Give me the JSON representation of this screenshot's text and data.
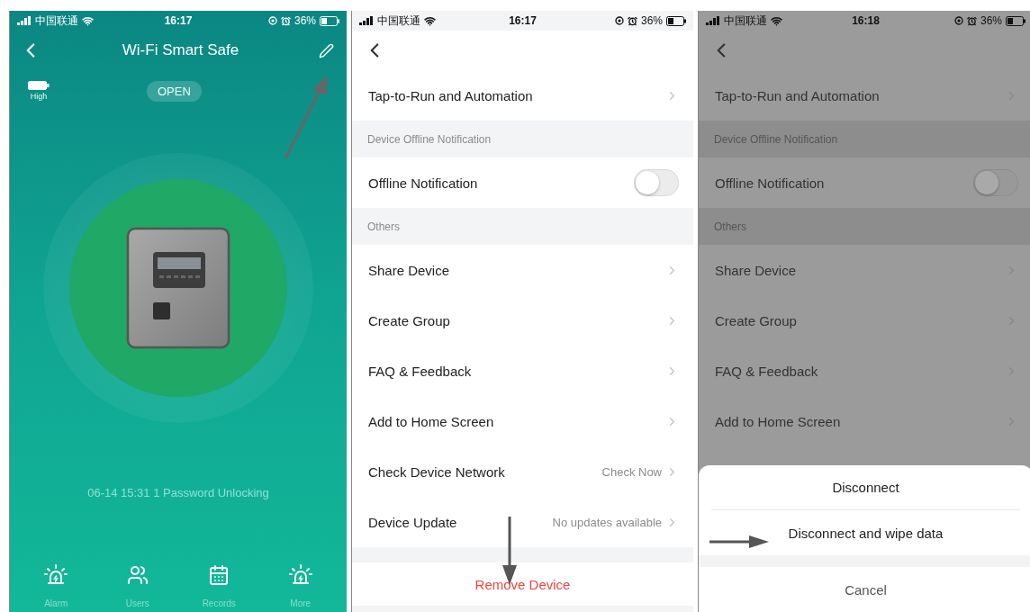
{
  "device_screen": {
    "status_bar": {
      "carrier": "中国联通",
      "time": "16:17",
      "battery": "36%"
    },
    "title": "Wi-Fi Smart Safe",
    "battery_label": "High",
    "lock_state": "OPEN",
    "last_event": "06-14 15:31  1 Password Unlocking",
    "nav": [
      {
        "kind": "alarm",
        "label": "Alarm"
      },
      {
        "kind": "users",
        "label": "Users"
      },
      {
        "kind": "records",
        "label": "Records"
      },
      {
        "kind": "alarm",
        "label": "More"
      }
    ]
  },
  "settings_screen": {
    "status_bar": {
      "carrier": "中国联通",
      "time": "16:17",
      "battery": "36%"
    },
    "rows": [
      {
        "kind": "link",
        "label": "Tap-to-Run and Automation"
      },
      {
        "kind": "section",
        "label": "Device Offline Notification"
      },
      {
        "kind": "toggle",
        "label": "Offline Notification",
        "on": false
      },
      {
        "kind": "section",
        "label": "Others"
      },
      {
        "kind": "link",
        "label": "Share Device"
      },
      {
        "kind": "link",
        "label": "Create Group"
      },
      {
        "kind": "link",
        "label": "FAQ & Feedback"
      },
      {
        "kind": "link",
        "label": "Add to Home Screen"
      },
      {
        "kind": "value",
        "label": "Check Device Network",
        "value": "Check Now"
      },
      {
        "kind": "value",
        "label": "Device Update",
        "value": "No updates available"
      }
    ],
    "remove_button": "Remove Device"
  },
  "disconnect_screen": {
    "status_bar": {
      "carrier": "中国联通",
      "time": "16:18",
      "battery": "36%"
    },
    "rows": [
      {
        "kind": "link",
        "label": "Tap-to-Run and Automation"
      },
      {
        "kind": "section",
        "label": "Device Offline Notification"
      },
      {
        "kind": "toggle",
        "label": "Offline Notification",
        "on": false
      },
      {
        "kind": "section",
        "label": "Others"
      },
      {
        "kind": "link",
        "label": "Share Device"
      },
      {
        "kind": "link",
        "label": "Create Group"
      },
      {
        "kind": "link",
        "label": "FAQ & Feedback"
      },
      {
        "kind": "link",
        "label": "Add to Home Screen"
      }
    ],
    "sheet": {
      "options": [
        "Disconnect",
        "Disconnect and wipe data"
      ],
      "cancel": "Cancel"
    }
  }
}
